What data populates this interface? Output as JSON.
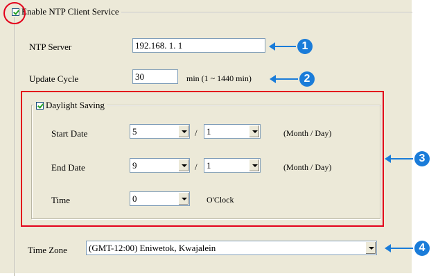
{
  "ntp_client": {
    "enable_label": "Enable NTP Client Service",
    "enable_checked": true,
    "ntp_server": {
      "label": "NTP Server",
      "value": "192.168.  1.  1"
    },
    "update_cycle": {
      "label": "Update Cycle",
      "value": "30",
      "unit": "min (1 ~ 1440 min)"
    }
  },
  "daylight_saving": {
    "label": "Daylight Saving",
    "checked": true,
    "start_date": {
      "label": "Start Date",
      "month": "5",
      "day": "1",
      "separator": "/",
      "hint": "(Month / Day)"
    },
    "end_date": {
      "label": "End Date",
      "month": "9",
      "day": "1",
      "separator": "/",
      "hint": "(Month / Day)"
    },
    "time": {
      "label": "Time",
      "value": "0",
      "unit": "O'Clock"
    }
  },
  "time_zone": {
    "label": "Time Zone",
    "value": "(GMT-12:00) Eniwetok, Kwajalein"
  },
  "callouts": [
    "1",
    "2",
    "3",
    "4"
  ],
  "colors": {
    "callout_blue": "#1a7cd9",
    "highlight_red": "#e3001b",
    "dialog_bg": "#ece9d8"
  }
}
